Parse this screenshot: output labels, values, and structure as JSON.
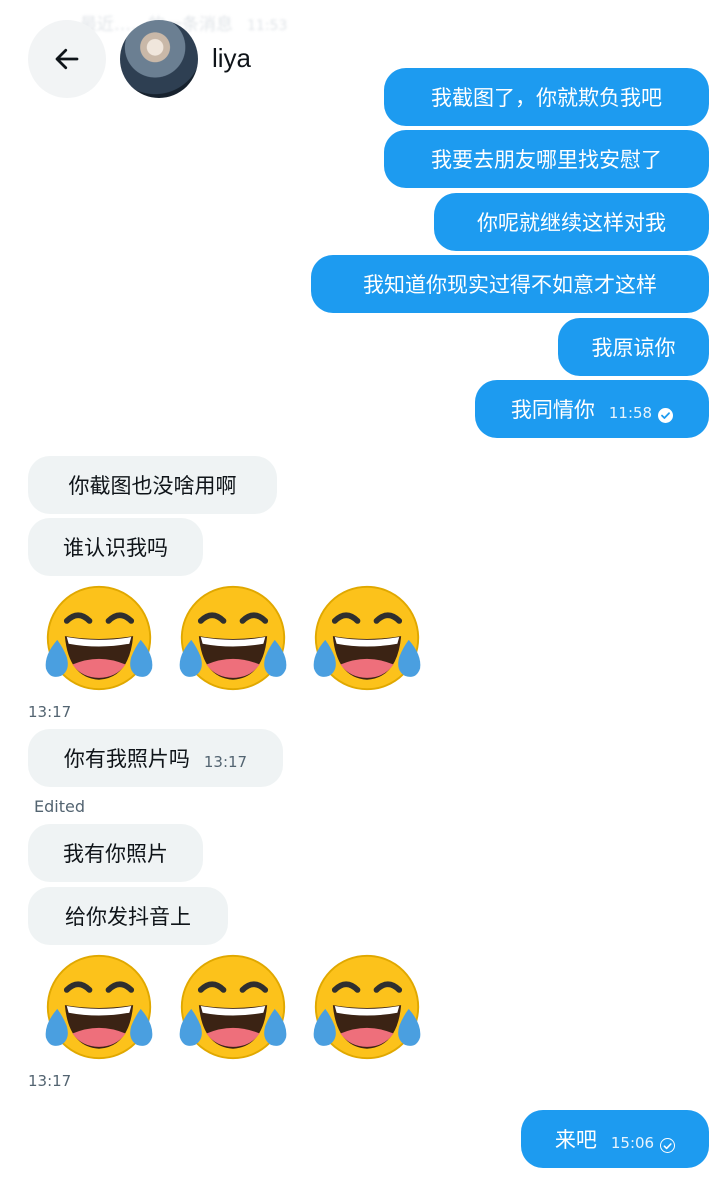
{
  "header": {
    "contact_name": "liya",
    "back_icon": "arrow-left-icon",
    "ghost_text": "最近……的一条消息",
    "ghost_time": "11:53"
  },
  "messages": {
    "m1": {
      "text": "我截图了，你就欺负我吧"
    },
    "m2": {
      "text": "我要去朋友哪里找安慰了"
    },
    "m3": {
      "text": "你呢就继续这样对我"
    },
    "m4": {
      "text": "我知道你现实过得不如意才这样"
    },
    "m5": {
      "text": "我原谅你"
    },
    "m6": {
      "text": "我同情你",
      "time": "11:58"
    },
    "m7": {
      "text": "你截图也没啥用啊"
    },
    "m8": {
      "text": "谁认识我吗"
    },
    "m9_time": "13:17",
    "m10": {
      "text": "你有我照片吗",
      "time": "13:17",
      "edited": "Edited"
    },
    "m11": {
      "text": "我有你照片"
    },
    "m12": {
      "text": "给你发抖音上"
    },
    "m13_time": "13:17",
    "m14": {
      "text": "来吧",
      "time": "15:06"
    }
  },
  "emoji": {
    "name": "face-with-tears-of-joy",
    "count_per_row": 3
  },
  "colors": {
    "outgoing_bubble": "#1d9bf0",
    "incoming_bubble": "#eff3f4",
    "emoji_face": "#fcc21b",
    "emoji_tears": "#4a9fe0"
  }
}
